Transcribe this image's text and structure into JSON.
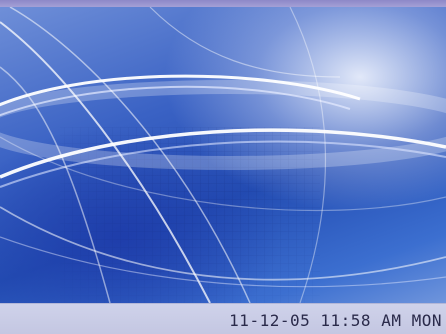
{
  "status_bar": {
    "date": "11-12-05",
    "time": "11:58",
    "meridiem": "AM",
    "weekday": "MON"
  },
  "wallpaper": {
    "description_icon": "abstract-arcs-wallpaper"
  },
  "colors": {
    "top_bar": "#9a96d0",
    "status_bar": "#c9cde6",
    "clock_text": "#2a2a4a",
    "wallpaper_base": "#2f5ac0"
  }
}
